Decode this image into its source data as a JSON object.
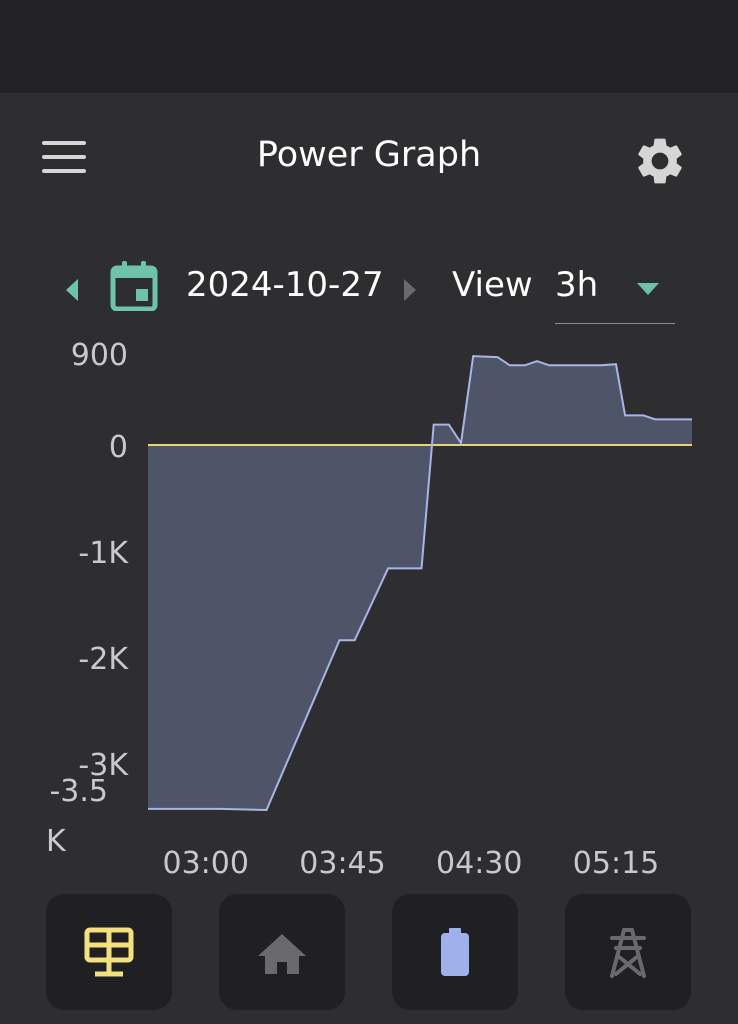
{
  "app": {
    "title": "Power Graph"
  },
  "header": {
    "menu_icon": "hamburger-menu-icon",
    "settings_icon": "gear-icon"
  },
  "date_nav": {
    "date": "2024-10-27",
    "view_label": "View",
    "view_value": "3h",
    "accent_color": "#6fc3a8"
  },
  "chart_data": {
    "type": "area",
    "title": "",
    "xlabel": "",
    "ylabel": "",
    "y_ticks": [
      "900",
      "0",
      "-1K",
      "-2K",
      "-3K",
      "-3.5\nK"
    ],
    "y_tick_values": [
      900,
      0,
      -1000,
      -2000,
      -3000,
      -3500
    ],
    "x_ticks": [
      "03:00",
      "03:45",
      "04:30",
      "05:15"
    ],
    "x_tick_minutes": [
      180,
      225,
      270,
      315
    ],
    "xlim_minutes": [
      161,
      340
    ],
    "ylim": [
      -3500,
      900
    ],
    "line_color": "#a9b5e8",
    "fill_color": "#4f5568",
    "zero_line_color": "#e8d37a",
    "grid": false,
    "series": [
      {
        "points_minutes": [
          [
            161,
            -3450
          ],
          [
            185,
            -3450
          ],
          [
            200,
            -3460
          ],
          [
            224,
            -1850
          ],
          [
            229,
            -1850
          ],
          [
            240,
            -1170
          ],
          [
            251,
            -1170
          ],
          [
            255,
            200
          ],
          [
            260,
            200
          ],
          [
            264,
            20
          ],
          [
            268,
            870
          ],
          [
            276,
            860
          ],
          [
            280,
            780
          ],
          [
            285,
            780
          ],
          [
            289,
            820
          ],
          [
            293,
            780
          ],
          [
            310,
            780
          ],
          [
            315,
            790
          ],
          [
            318,
            290
          ],
          [
            324,
            290
          ],
          [
            328,
            250
          ],
          [
            340,
            250
          ]
        ]
      }
    ]
  },
  "bottom_nav": {
    "tabs": [
      {
        "icon": "solar-panel-icon",
        "active": true,
        "color": "#f5e07e"
      },
      {
        "icon": "home-icon",
        "active": false,
        "color": "#6a6a6c"
      },
      {
        "icon": "battery-icon",
        "active": false,
        "color": "#9fb0ea"
      },
      {
        "icon": "power-tower-icon",
        "active": false,
        "color": "#6a6a6c"
      }
    ]
  }
}
